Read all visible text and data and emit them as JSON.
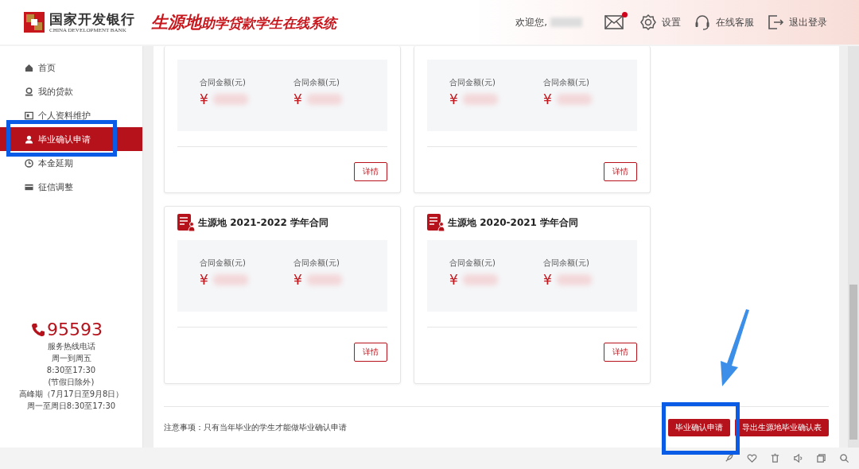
{
  "header": {
    "bank_name": "国家开发银行",
    "bank_name_en": "CHINA DEVELOPMENT BANK",
    "system_title_lead": "生源地",
    "system_title_rest": "助学贷款学生在线系统",
    "welcome": "欢迎您,",
    "mail_unread": true,
    "links": [
      "设置",
      "在线客服",
      "退出登录"
    ]
  },
  "sidebar": {
    "items": [
      {
        "label": "首页",
        "selected": false
      },
      {
        "label": "我的贷款",
        "selected": false
      },
      {
        "label": "个人资料维护",
        "selected": false
      },
      {
        "label": "毕业确认申请",
        "selected": true
      },
      {
        "label": "本金延期",
        "selected": false
      },
      {
        "label": "征信调整",
        "selected": false
      }
    ],
    "hotline": {
      "number": "95593",
      "lines": [
        "服务热线电话",
        "周一到周五",
        "8:30至17:30",
        "(节假日除外)",
        "高峰期（7月17日至9月8日）",
        "周一至周日8:30至17:30"
      ]
    }
  },
  "contracts": [
    {
      "amount_label": "合同金额(元)",
      "amount_currency": "¥",
      "balance_label": "合同余额(元)",
      "balance_currency": "¥",
      "button": "详情"
    },
    {
      "amount_label": "合同金额(元)",
      "amount_currency": "¥",
      "balance_label": "合同余额(元)",
      "balance_currency": "¥",
      "button": "详情"
    },
    {
      "title": "生源地 2021-2022 学年合同",
      "amount_label": "合同金额(元)",
      "amount_currency": "¥",
      "balance_label": "合同余额(元)",
      "balance_currency": "¥",
      "button": "详情"
    },
    {
      "title": "生源地 2020-2021 学年合同",
      "amount_label": "合同金额(元)",
      "amount_currency": "¥",
      "balance_label": "合同余额(元)",
      "balance_currency": "¥",
      "button": "详情"
    }
  ],
  "notice": "注意事项：只有当年毕业的学生才能做毕业确认申请",
  "actions": [
    "毕业确认申请",
    "导出生源地毕业确认表"
  ]
}
